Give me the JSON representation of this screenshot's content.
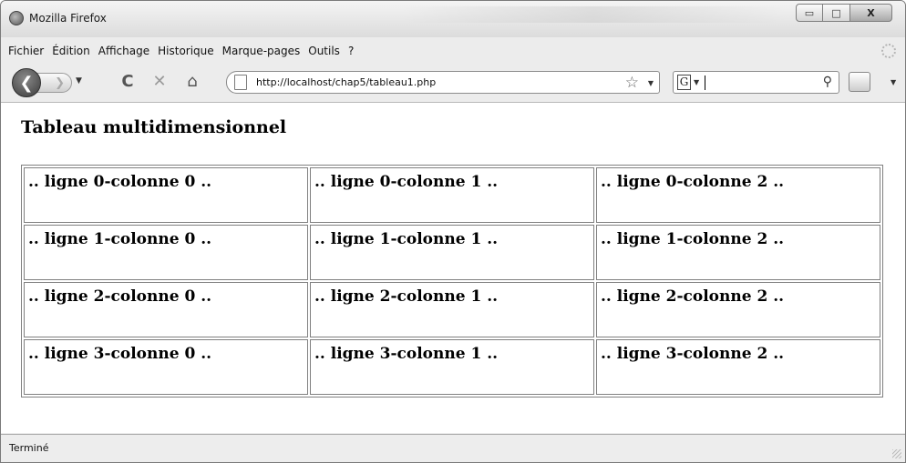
{
  "window": {
    "title": "Mozilla Firefox",
    "controls": {
      "minimize": "▭",
      "maximize": "□",
      "close": "X"
    }
  },
  "menubar": {
    "items": [
      "Fichier",
      "Édition",
      "Affichage",
      "Historique",
      "Marque-pages",
      "Outils",
      "?"
    ]
  },
  "navbar": {
    "back_glyph": "❮",
    "forward_glyph": "❯",
    "reload_glyph": "C",
    "stop_glyph": "✕",
    "home_glyph": "⌂",
    "url": "http://localhost/chap5/tableau1.php",
    "bookmark_glyph": "☆",
    "search_engine_glyph": "G",
    "search_value": "",
    "search_glyph": "⚲"
  },
  "page": {
    "title": "Tableau multidimensionnel",
    "table": [
      [
        ".. ligne 0-colonne 0 ..",
        ".. ligne 0-colonne 1 ..",
        ".. ligne 0-colonne 2 .."
      ],
      [
        ".. ligne 1-colonne 0 ..",
        ".. ligne 1-colonne 1 ..",
        ".. ligne 1-colonne 2 .."
      ],
      [
        ".. ligne 2-colonne 0 ..",
        ".. ligne 2-colonne 1 ..",
        ".. ligne 2-colonne 2 .."
      ],
      [
        ".. ligne 3-colonne 0 ..",
        ".. ligne 3-colonne 1 ..",
        ".. ligne 3-colonne 2 .."
      ]
    ]
  },
  "statusbar": {
    "text": "Terminé"
  },
  "icons": {
    "app": "firefox-icon",
    "back": "back-arrow-icon",
    "forward": "forward-arrow-icon",
    "reload": "reload-icon",
    "stop": "stop-icon",
    "home": "home-icon",
    "page": "page-icon",
    "bookmark": "star-icon",
    "search": "magnifier-icon",
    "tools": "tools-icon"
  }
}
